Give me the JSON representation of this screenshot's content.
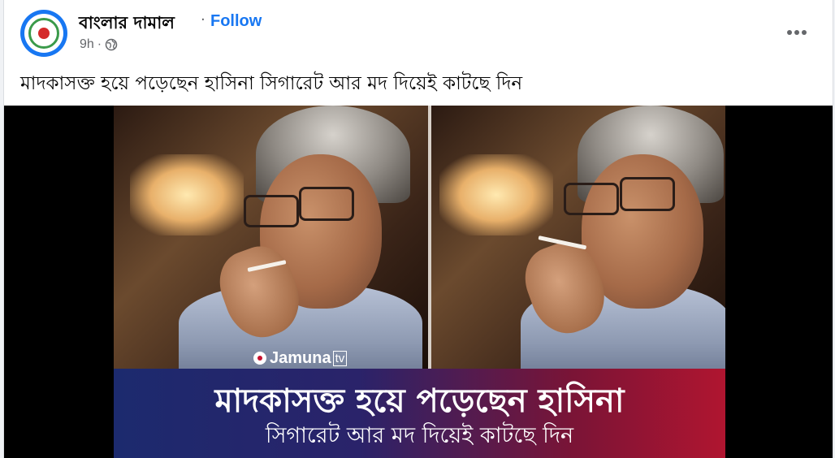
{
  "post": {
    "page_name": "বাংলার দামাল",
    "separator": "·",
    "follow_label": "Follow",
    "time": "9h",
    "meta_separator": "·",
    "caption": "মাদকাসক্ত হয়ে পড়েছেন হাসিনা সিগারেট আর মদ দিয়েই কাটছে দিন"
  },
  "image": {
    "logo_text": "Jamuna",
    "logo_tv": "tv",
    "banner_line1": "মাদকাসক্ত হয়ে পড়েছেন হাসিনা",
    "banner_line2": "সিগারেট আর মদ দিয়েই কাটছে দিন"
  },
  "icons": {
    "globe": "globe-icon",
    "more": "more-options-icon"
  },
  "colors": {
    "follow": "#1877f2",
    "meta": "#65676b",
    "text": "#050505",
    "banner_left": "#1c2a6e",
    "banner_right": "#b01530"
  }
}
